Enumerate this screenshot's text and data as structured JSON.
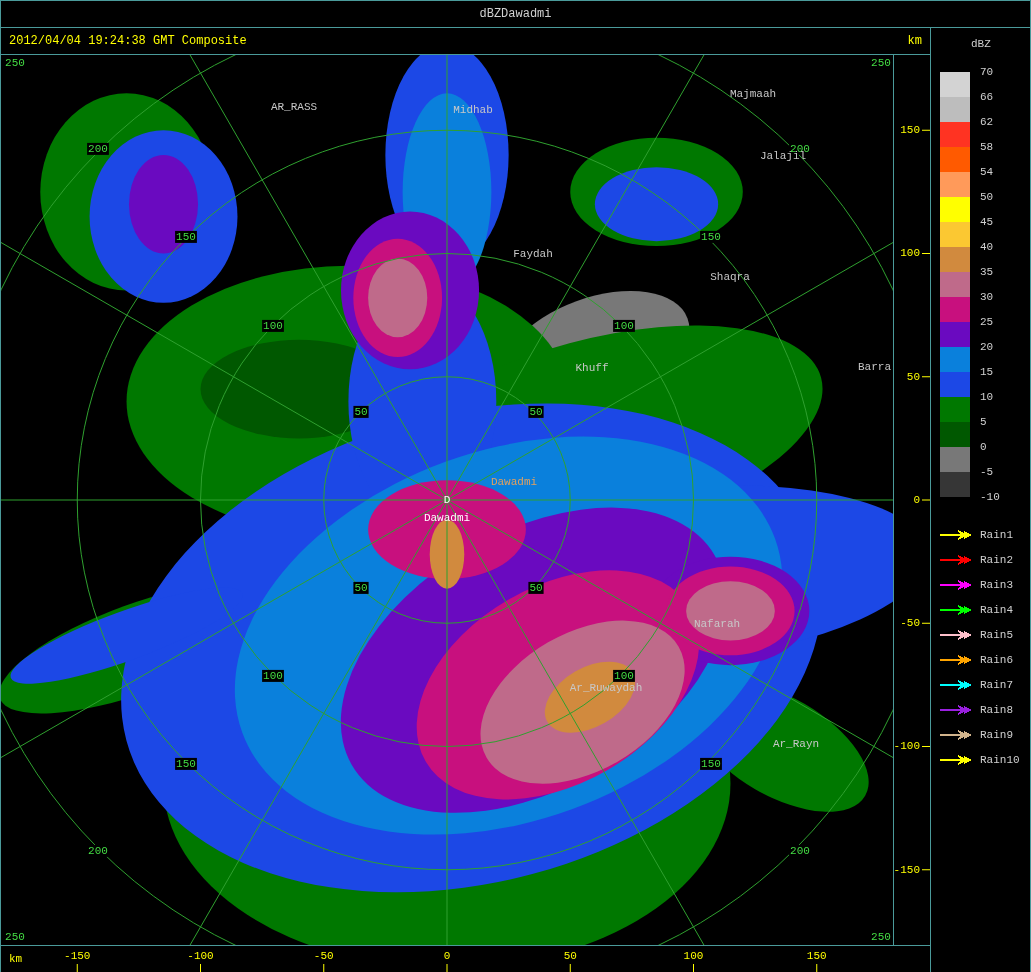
{
  "window": {
    "title": "dBZDawadmi"
  },
  "header": {
    "timestamp": "2012/04/04 19:24:38 GMT Composite",
    "unit": "km"
  },
  "map": {
    "center_marker": "D",
    "range_labels": [
      "250",
      "250",
      "200",
      "200",
      "150",
      "150",
      "100",
      "100",
      "50",
      "50",
      "50",
      "50",
      "100",
      "100",
      "150",
      "150",
      "200",
      "200",
      "250",
      "250"
    ],
    "places": [
      {
        "name": "AR_RASS"
      },
      {
        "name": "Midhab"
      },
      {
        "name": "Majmaah"
      },
      {
        "name": "Jalajil"
      },
      {
        "name": "Faydah"
      },
      {
        "name": "Shaqra"
      },
      {
        "name": "Khuff"
      },
      {
        "name": "Barra"
      },
      {
        "name": "Dawadmi"
      },
      {
        "name": "Dawadmi"
      },
      {
        "name": "Nafarah"
      },
      {
        "name": "Ar_Ruwaydah"
      },
      {
        "name": "Ar_Rayn"
      }
    ]
  },
  "y_axis": {
    "ticks": [
      "150",
      "100",
      "50",
      "0",
      "-50",
      "-100",
      "-150"
    ]
  },
  "x_axis": {
    "unit": "km",
    "ticks": [
      "-150",
      "-100",
      "-50",
      "0",
      "50",
      "100",
      "150"
    ]
  },
  "legend": {
    "title": "dBZ",
    "bands": [
      {
        "color": "#d3d3d3"
      },
      {
        "color": "#bdbdbd"
      },
      {
        "color": "#ff3322"
      },
      {
        "color": "#ff5a00"
      },
      {
        "color": "#ff9a5a"
      },
      {
        "color": "#ffff00"
      },
      {
        "color": "#fbc832"
      },
      {
        "color": "#d18a3e"
      },
      {
        "color": "#bf6a8a"
      },
      {
        "color": "#c8107e"
      },
      {
        "color": "#6a0ac0"
      },
      {
        "color": "#0a80dc"
      },
      {
        "color": "#1c48e6"
      },
      {
        "color": "#007800"
      },
      {
        "color": "#005800"
      },
      {
        "color": "#787878"
      },
      {
        "color": "#363636"
      }
    ],
    "labels": [
      "70",
      "66",
      "62",
      "58",
      "54",
      "50",
      "45",
      "40",
      "35",
      "30",
      "25",
      "20",
      "15",
      "10",
      "5",
      "0",
      "-5",
      "-10"
    ],
    "tracks": [
      {
        "name": "Rain1",
        "color": "#ffff00"
      },
      {
        "name": "Rain2",
        "color": "#ff0000"
      },
      {
        "name": "Rain3",
        "color": "#ff00ff"
      },
      {
        "name": "Rain4",
        "color": "#00ff00"
      },
      {
        "name": "Rain5",
        "color": "#ffc0cb"
      },
      {
        "name": "Rain6",
        "color": "#ffa500"
      },
      {
        "name": "Rain7",
        "color": "#00ffff"
      },
      {
        "name": "Rain8",
        "color": "#9a20e0"
      },
      {
        "name": "Rain9",
        "color": "#d2b48c"
      },
      {
        "name": "Rain10",
        "color": "#ffff00"
      }
    ]
  }
}
